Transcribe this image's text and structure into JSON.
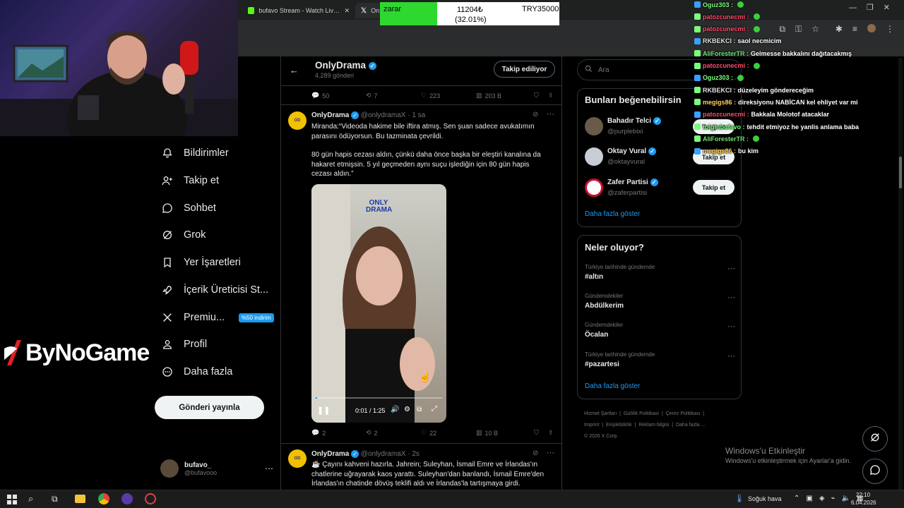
{
  "browser": {
    "tabs": [
      {
        "label": "bufavo Stream - Watch Live on",
        "icon": "kick-icon"
      },
      {
        "label": "On",
        "icon": "x-icon"
      }
    ]
  },
  "overlay": {
    "status": "zarar",
    "amount": "11204₺",
    "percent": "(32.01%)",
    "target": "TRY35000"
  },
  "sidebar": {
    "items": [
      {
        "label": "Bildirimler",
        "icon": "bell-icon"
      },
      {
        "label": "Takip et",
        "icon": "person-plus-icon"
      },
      {
        "label": "Sohbet",
        "icon": "chat-bubble-icon"
      },
      {
        "label": "Grok",
        "icon": "grok-icon"
      },
      {
        "label": "Yer İşaretleri",
        "icon": "bookmark-icon"
      },
      {
        "label": "İçerik Üreticisi St...",
        "icon": "rocket-icon"
      },
      {
        "label": "Premiu...",
        "icon": "x-logo-icon",
        "badge": "%50 indirim"
      },
      {
        "label": "Profil",
        "icon": "person-icon"
      },
      {
        "label": "Daha fazla",
        "icon": "more-circle-icon"
      }
    ],
    "post_button": "Gönderi yayınla",
    "account": {
      "name": "bufavo_",
      "handle": "@bufavooo"
    }
  },
  "brand_logo": "ByNoGame",
  "header": {
    "title": "OnlyDrama",
    "subtitle": "4.289 gönderi",
    "follow_label": "Takip ediliyor"
  },
  "top_stats": {
    "replies": "50",
    "reposts": "7",
    "likes": "223",
    "views": "203 B"
  },
  "tweet1": {
    "name": "OnlyDrama",
    "handle": "@onlydramaX · 1 sa",
    "text1": "Miranda:“Videoda hakime bile iftira atmış. Sen şuan sadece avukatımın parasını ödüyorsun. Bu tazminata çevrildi.",
    "text2": "80 gün hapis cezası aldın, çünkü daha önce başka bir eleştiri kanalına da hakaret etmişsin. 5 yıl geçmeden aynı suçu işlediğin için 80 gün hapis cezası aldın.”",
    "video_watermark": "ONLY DRAMA",
    "video_time": "0:01 / 1:25",
    "video_progress": 0.01,
    "stats": {
      "replies": "2",
      "reposts": "2",
      "likes": "22",
      "views": "10 B"
    }
  },
  "tweet2": {
    "name": "OnlyDrama",
    "handle": "@onlydramaX · 2s",
    "text": "☕ Çayını kahveni hazırla. Jahrein; Suleyhan, İsmail Emre ve İrlandas'ın chatlerine uğrayarak kaos yarattı. Suleyhan'dan banlandı, İsmail Emre'den İrlandas'ın chatinde dövüş teklifi aldı ve İrlandas'la tartışmaya girdi."
  },
  "right": {
    "search_placeholder": "Ara",
    "suggestions_title": "Bunları beğenebilirsin",
    "suggestions": [
      {
        "name": "Bahadır Telci",
        "handle": "@purplebixi",
        "button": "Takip et"
      },
      {
        "name": "Oktay Vural",
        "handle": "@oktayvural",
        "button": "Takip et"
      },
      {
        "name": "Zafer Partisi",
        "handle": "@zaferpartisi",
        "button": "Takip et"
      }
    ],
    "show_more": "Daha fazla göster",
    "trends_title": "Neler oluyor?",
    "trends": [
      {
        "category": "Türkiye tarihinde gündemde",
        "name": "#altın"
      },
      {
        "category": "Gündemdekiler",
        "name": "Abdülkerim"
      },
      {
        "category": "Gündemdekiler",
        "name": "Öcalan"
      },
      {
        "category": "Türkiye tarihinde gündemde",
        "name": "#pazartesi"
      }
    ],
    "trends_more": "Daha fazla göster",
    "footer": [
      "Hizmet Şartları",
      "Gizlilik Politikası",
      "Çerez Politikası",
      "Imprint",
      "Erişilebilirlik",
      "Reklam bilgisi",
      "Daha fazla ...",
      "© 2026 X Corp."
    ]
  },
  "chat": [
    {
      "user": "Oguz303 :",
      "msg": "",
      "color": "#7cfc7c"
    },
    {
      "user": "patozcunecmi :",
      "msg": "",
      "color": "#ff4d6d"
    },
    {
      "user": "patozcunecmi :",
      "msg": "",
      "color": "#ff4d6d"
    },
    {
      "user": "RKBEKCI :",
      "msg": "saol necmicim",
      "color": "#e0e0e0"
    },
    {
      "user": "AliForesterTR :",
      "msg": "Gelmesse bakkalını dağıtacakmış",
      "color": "#6fe06f"
    },
    {
      "user": "patozcunecmi :",
      "msg": "",
      "color": "#ff4d6d"
    },
    {
      "user": "Oguz303 :",
      "msg": "",
      "color": "#7cfc7c"
    },
    {
      "user": "RKBEKCI :",
      "msg": "düzeleyim göndereceğim",
      "color": "#e0e0e0"
    },
    {
      "user": "megigs86 :",
      "msg": "direksiyonu NABİCAN kel ehliyet var mi",
      "color": "#ffd15c"
    },
    {
      "user": "patozcunecmi :",
      "msg": "Bakkala Molotof atacaklar",
      "color": "#ff4d6d"
    },
    {
      "user": "tolginbufavo :",
      "msg": "tehdit etmiyoz he yanlis anlama baba",
      "color": "#7cfc7c"
    },
    {
      "user": "AliForesterTR :",
      "msg": "",
      "color": "#6fe06f"
    },
    {
      "user": "megigs86 :",
      "msg": "bu kim",
      "color": "#ffd15c"
    }
  ],
  "watermark": {
    "title": "Windows'u Etkinleştir",
    "subtitle": "Windows'u etkinleştirmek için Ayarlar'a gidin."
  },
  "taskbar": {
    "weather": "Soğuk hava",
    "time": "22:10",
    "date": "6.04.2026"
  }
}
